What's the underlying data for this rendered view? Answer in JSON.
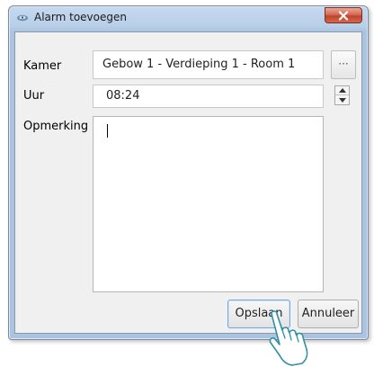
{
  "window": {
    "title": "Alarm toevoegen",
    "close_icon": "close-icon"
  },
  "form": {
    "room_label": "Kamer",
    "room_value": "Gebow 1 - Verdieping 1 - Room 1",
    "room_browse_label": "···",
    "time_label": "Uur",
    "time_value": "08:24",
    "remark_label": "Opmerking",
    "remark_value": ""
  },
  "buttons": {
    "save_label": "Opslaan",
    "cancel_label": "Annuleer"
  },
  "colors": {
    "titlebar": "#b9cfe8",
    "close_red": "#c2432c",
    "client_bg": "#f0f0f0",
    "focus_blue": "#7aa7d6"
  }
}
